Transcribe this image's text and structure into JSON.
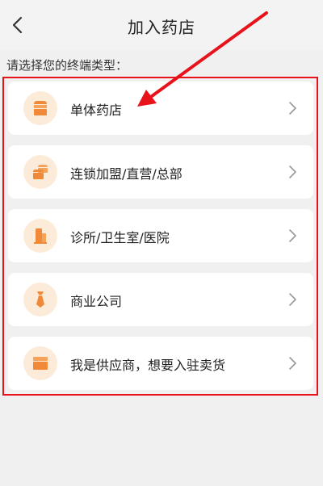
{
  "header": {
    "title": "加入药店",
    "back_icon": "chevron-left-icon"
  },
  "prompt": "请选择您的终端类型：",
  "options": [
    {
      "label": "单体药店",
      "icon": "store-icon"
    },
    {
      "label": "连锁加盟/直营/总部",
      "icon": "chain-store-icon"
    },
    {
      "label": "诊所/卫生室/医院",
      "icon": "clinic-building-icon"
    },
    {
      "label": "商业公司",
      "icon": "tie-icon"
    },
    {
      "label": "我是供应商，想要入驻卖货",
      "icon": "supplier-box-icon"
    }
  ],
  "colors": {
    "accent": "#f08a38",
    "icon_bg": "#fdebd9",
    "annotation_red": "#e8121b",
    "background": "#f0f0f0"
  }
}
